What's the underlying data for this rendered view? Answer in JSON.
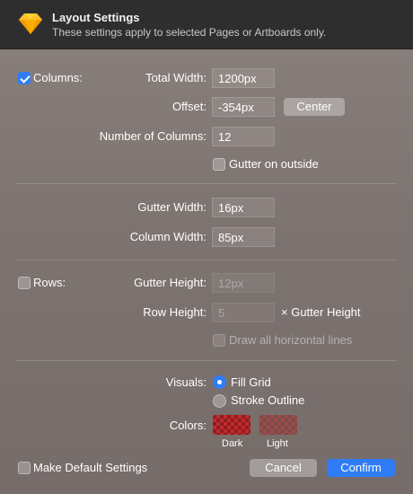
{
  "header": {
    "title": "Layout Settings",
    "subtitle": "These settings apply to selected Pages or Artboards only.",
    "icon": "sketch-diamond-icon"
  },
  "columns": {
    "toggle_label": "Columns:",
    "enabled": true,
    "total_width_label": "Total Width:",
    "total_width_value": "1200px",
    "offset_label": "Offset:",
    "offset_value": "-354px",
    "center_button": "Center",
    "number_label": "Number of Columns:",
    "number_value": "12",
    "gutter_outside_label": "Gutter on outside",
    "gutter_outside_checked": false,
    "gutter_width_label": "Gutter Width:",
    "gutter_width_value": "16px",
    "column_width_label": "Column Width:",
    "column_width_value": "85px"
  },
  "rows": {
    "toggle_label": "Rows:",
    "enabled": false,
    "gutter_height_label": "Gutter Height:",
    "gutter_height_value": "12px",
    "row_height_label": "Row Height:",
    "row_height_value": "5",
    "row_height_suffix": "× Gutter Height",
    "draw_lines_label": "Draw all horizontal lines"
  },
  "visuals": {
    "label": "Visuals:",
    "options": [
      "Fill Grid",
      "Stroke Outline"
    ],
    "selected": "Fill Grid"
  },
  "colors": {
    "label": "Colors:",
    "dark_caption": "Dark",
    "light_caption": "Light",
    "dark_color": "#c2292d",
    "light_color": "#9c4c4c"
  },
  "footer": {
    "default_label": "Make Default Settings",
    "cancel": "Cancel",
    "confirm": "Confirm"
  },
  "accent": "#2f7cf6"
}
